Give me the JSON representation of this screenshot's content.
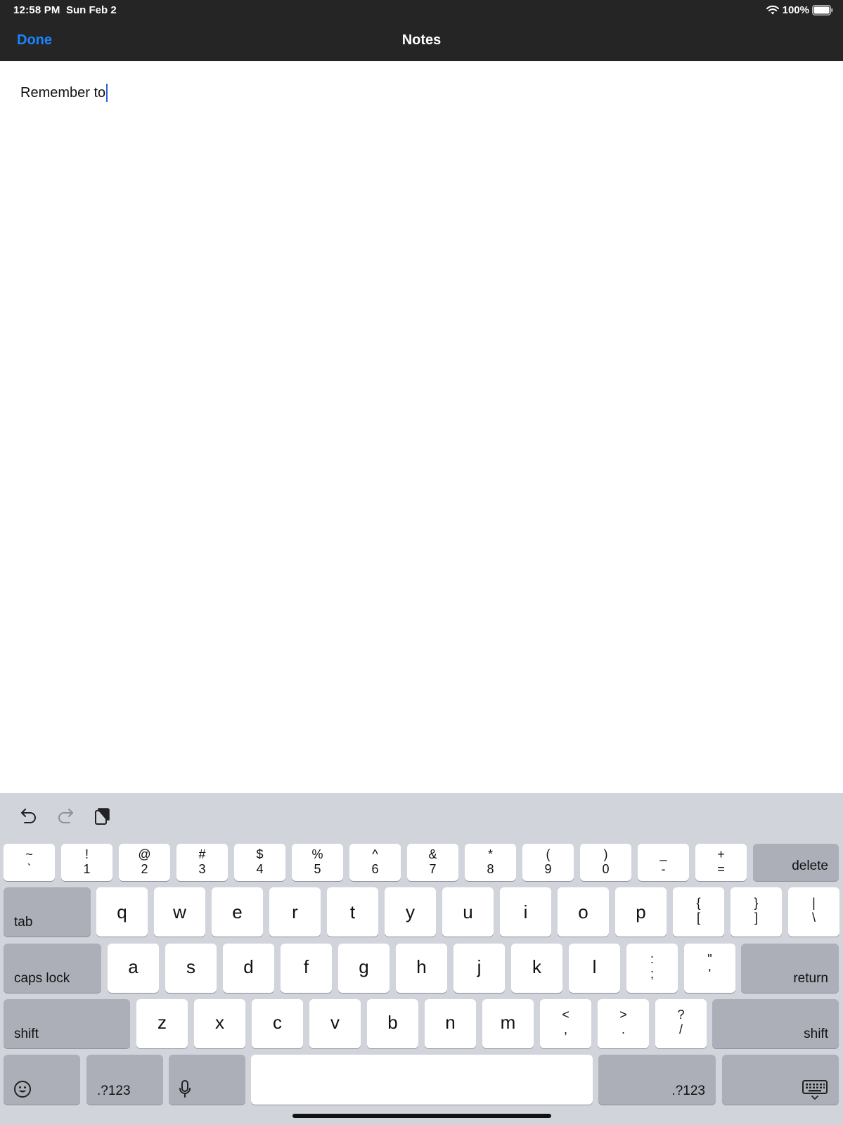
{
  "status_bar": {
    "time": "12:58 PM",
    "date": "Sun Feb 2",
    "battery_percent": "100%",
    "battery_level": 1.0,
    "wifi_icon": "wifi-icon",
    "battery_icon": "battery-icon"
  },
  "nav_bar": {
    "done_label": "Done",
    "title": "Notes"
  },
  "note": {
    "text": "Remember to"
  },
  "keyboard": {
    "toolbar": {
      "undo_icon": "undo-icon",
      "redo_icon": "redo-icon",
      "paste_icon": "clipboard-icon"
    },
    "number_row": [
      {
        "top": "~",
        "bottom": "`"
      },
      {
        "top": "!",
        "bottom": "1"
      },
      {
        "top": "@",
        "bottom": "2"
      },
      {
        "top": "#",
        "bottom": "3"
      },
      {
        "top": "$",
        "bottom": "4"
      },
      {
        "top": "%",
        "bottom": "5"
      },
      {
        "top": "^",
        "bottom": "6"
      },
      {
        "top": "&",
        "bottom": "7"
      },
      {
        "top": "*",
        "bottom": "8"
      },
      {
        "top": "(",
        "bottom": "9"
      },
      {
        "top": ")",
        "bottom": "0"
      },
      {
        "top": "_",
        "bottom": "-"
      },
      {
        "top": "+",
        "bottom": "="
      }
    ],
    "delete_label": "delete",
    "tab_label": "tab",
    "top_letters": [
      "q",
      "w",
      "e",
      "r",
      "t",
      "y",
      "u",
      "i",
      "o",
      "p"
    ],
    "top_symbols": [
      {
        "top": "{",
        "bottom": "["
      },
      {
        "top": "}",
        "bottom": "]"
      },
      {
        "top": "|",
        "bottom": "\\"
      }
    ],
    "caps_lock_label": "caps lock",
    "home_letters": [
      "a",
      "s",
      "d",
      "f",
      "g",
      "h",
      "j",
      "k",
      "l"
    ],
    "home_symbols": [
      {
        "top": ":",
        "bottom": ";"
      },
      {
        "top": "\"",
        "bottom": "'"
      }
    ],
    "return_label": "return",
    "shift_label": "shift",
    "bottom_letters": [
      "z",
      "x",
      "c",
      "v",
      "b",
      "n",
      "m"
    ],
    "bottom_symbols": [
      {
        "top": "<",
        "bottom": ","
      },
      {
        "top": ">",
        "bottom": "."
      },
      {
        "top": "?",
        "bottom": "/"
      }
    ],
    "numbers_label": ".?123",
    "emoji_icon": "emoji-icon",
    "mic_icon": "microphone-icon",
    "dismiss_icon": "keyboard-dismiss-icon"
  }
}
